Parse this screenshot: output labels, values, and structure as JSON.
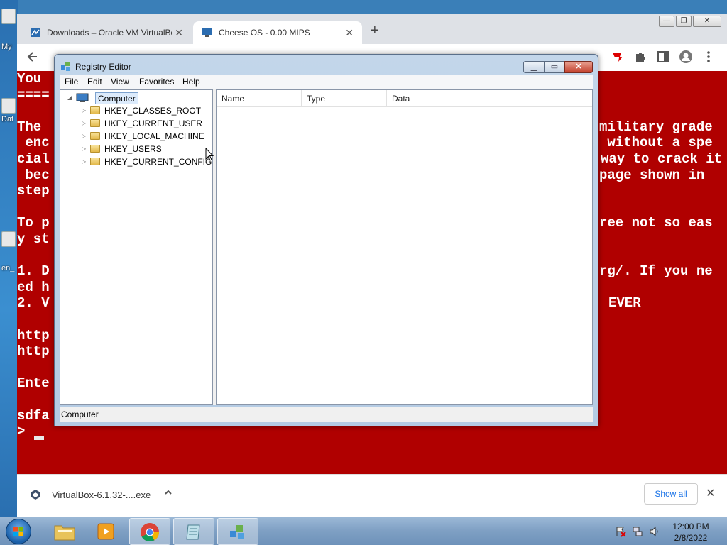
{
  "desktop": {
    "labels": [
      "My",
      "Dat",
      "en_"
    ]
  },
  "browser": {
    "tabs": [
      {
        "title": "Downloads – Oracle VM VirtualBox",
        "close": "✕"
      },
      {
        "title": "Cheese OS - 0.00 MIPS",
        "close": "✕"
      }
    ],
    "new_tab": "+",
    "window_controls": {
      "minimize": "—",
      "restore": "❐",
      "close": "✕"
    }
  },
  "terminal": {
    "lines": [
      "You ",
      "====",
      "",
      "The ",
      " enc",
      "cial",
      " bec",
      "step",
      "",
      "To p",
      "y st",
      "",
      "1. D",
      "ed h",
      "2. V",
      "",
      "http",
      "http",
      "",
      "Ente",
      "",
      "sdfa",
      "> "
    ],
    "right_lines": [
      {
        "row": 3,
        "text": "military grade"
      },
      {
        "row": 4,
        "text": " without a spe"
      },
      {
        "row": 5,
        "text": "way to crack it"
      },
      {
        "row": 6,
        "text": "page shown in"
      },
      {
        "row": 9,
        "text": "ree not so eas"
      },
      {
        "row": 12,
        "text": "rg/. If you ne"
      },
      {
        "row": 14,
        "text": "EVER"
      }
    ]
  },
  "download_bar": {
    "file_name": "VirtualBox-6.1.32-....exe",
    "show_all": "Show all",
    "close": "✕"
  },
  "regedit": {
    "title": "Registry Editor",
    "menu": [
      "File",
      "Edit",
      "View",
      "Favorites",
      "Help"
    ],
    "tree_root": "Computer",
    "hives": [
      "HKEY_CLASSES_ROOT",
      "HKEY_CURRENT_USER",
      "HKEY_LOCAL_MACHINE",
      "HKEY_USERS",
      "HKEY_CURRENT_CONFIG"
    ],
    "columns": [
      "Name",
      "Type",
      "Data"
    ],
    "status": "Computer"
  },
  "taskbar": {
    "clock_time": "12:00 PM",
    "clock_date": "2/8/2022"
  },
  "colors": {
    "vm_screen": "#b00000",
    "terminal_text": "#ffffff",
    "link_blue": "#1a73e8"
  }
}
